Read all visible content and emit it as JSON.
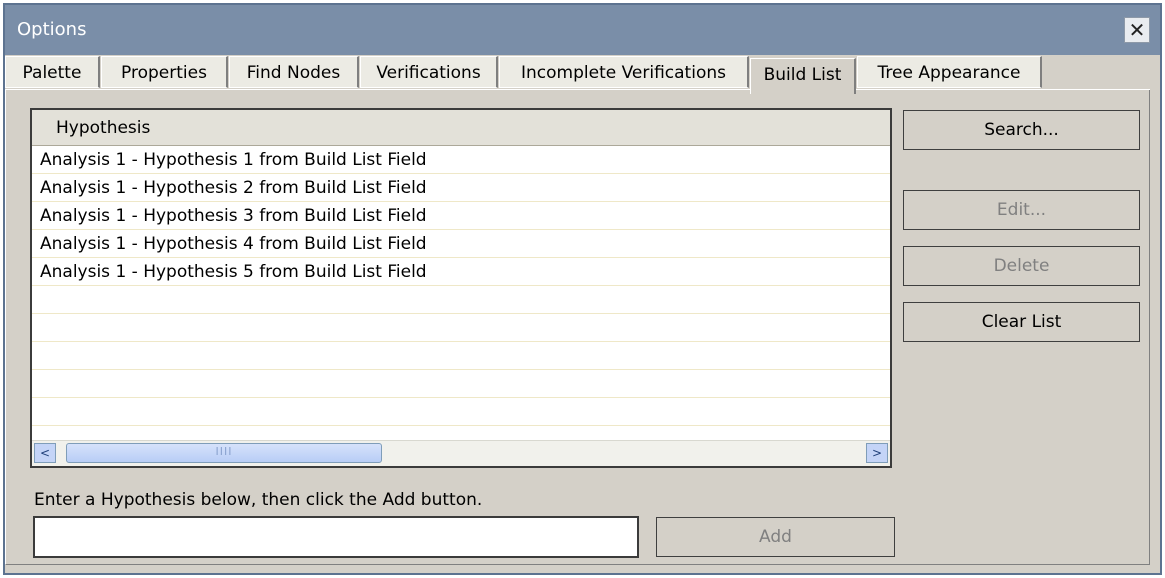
{
  "window": {
    "title": "Options",
    "close_glyph": "✕"
  },
  "tabs": [
    {
      "label": "Palette"
    },
    {
      "label": "Properties"
    },
    {
      "label": "Find Nodes"
    },
    {
      "label": "Verifications"
    },
    {
      "label": "Incomplete Verifications"
    },
    {
      "label": "Build List",
      "active": true
    },
    {
      "label": "Tree Appearance"
    }
  ],
  "list": {
    "column_header": "Hypothesis",
    "rows": [
      "Analysis 1 - Hypothesis 1 from Build List Field",
      "Analysis 1 - Hypothesis 2 from Build List Field",
      "Analysis 1 - Hypothesis 3 from Build List Field",
      "Analysis 1 - Hypothesis 4 from Build List Field",
      "Analysis 1 - Hypothesis 5 from Build List Field",
      "",
      "",
      "",
      "",
      ""
    ],
    "scroll_left": "<",
    "scroll_right": ">",
    "thumb_grip": "IIII"
  },
  "buttons": {
    "search": "Search...",
    "edit": "Edit...",
    "delete": "Delete",
    "clear": "Clear List",
    "add": "Add"
  },
  "entry": {
    "hint": "Enter a Hypothesis below, then click the Add button.",
    "value": "",
    "placeholder": ""
  }
}
